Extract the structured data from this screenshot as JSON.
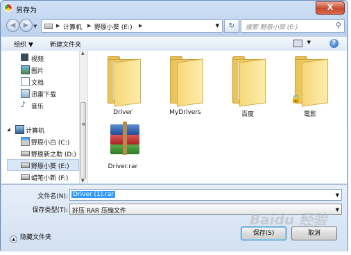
{
  "window": {
    "title": "另存为",
    "close_label": "X"
  },
  "nav": {
    "back_glyph": "◀",
    "forward_glyph": "▶",
    "breadcrumb": [
      "计算机",
      "野原小葵 (E:)"
    ],
    "refresh_glyph": "↻",
    "search_placeholder": "搜索 野原小葵 (E:)",
    "search_icon": "magnifier-icon"
  },
  "toolbar": {
    "organize": "组织 ▼",
    "new_folder": "新建文件夹",
    "help": "?"
  },
  "sidebar": {
    "items": [
      {
        "label": "视频",
        "icon": "video-icon"
      },
      {
        "label": "图片",
        "icon": "picture-icon"
      },
      {
        "label": "文档",
        "icon": "document-icon"
      },
      {
        "label": "迅雷下载",
        "icon": "download-folder-icon"
      },
      {
        "label": "音乐",
        "icon": "music-icon"
      },
      {
        "label": "计算机",
        "icon": "computer-icon"
      },
      {
        "label": "野原小白 (C:)",
        "icon": "system-drive-icon"
      },
      {
        "label": "野原新之助 (D:)",
        "icon": "drive-icon"
      },
      {
        "label": "野原小葵 (E:)",
        "icon": "drive-icon",
        "selected": true
      },
      {
        "label": "蜡笔小新 (F:)",
        "icon": "drive-icon"
      }
    ]
  },
  "files": [
    {
      "name": "Driver",
      "type": "folder-with-papers"
    },
    {
      "name": "MyDrivers",
      "type": "folder"
    },
    {
      "name": "百度",
      "type": "folder-with-documents"
    },
    {
      "name": "電影",
      "type": "locked-folder"
    },
    {
      "name": "Driver.rar",
      "type": "rar-archive"
    }
  ],
  "save_form": {
    "filename_label": "文件名(N):",
    "filename_value": "Driver (1).rar",
    "filetype_label": "保存类型(T):",
    "filetype_value": "好压 RAR 压缩文件",
    "hide_folders": "隐藏文件夹",
    "save_button": "保存(S)",
    "cancel_button": "取消"
  },
  "watermark": "Baidu 经验",
  "colors": {
    "accent": "#3399ff",
    "titlebar": "#cfe0f5",
    "close": "#c74a2e"
  }
}
